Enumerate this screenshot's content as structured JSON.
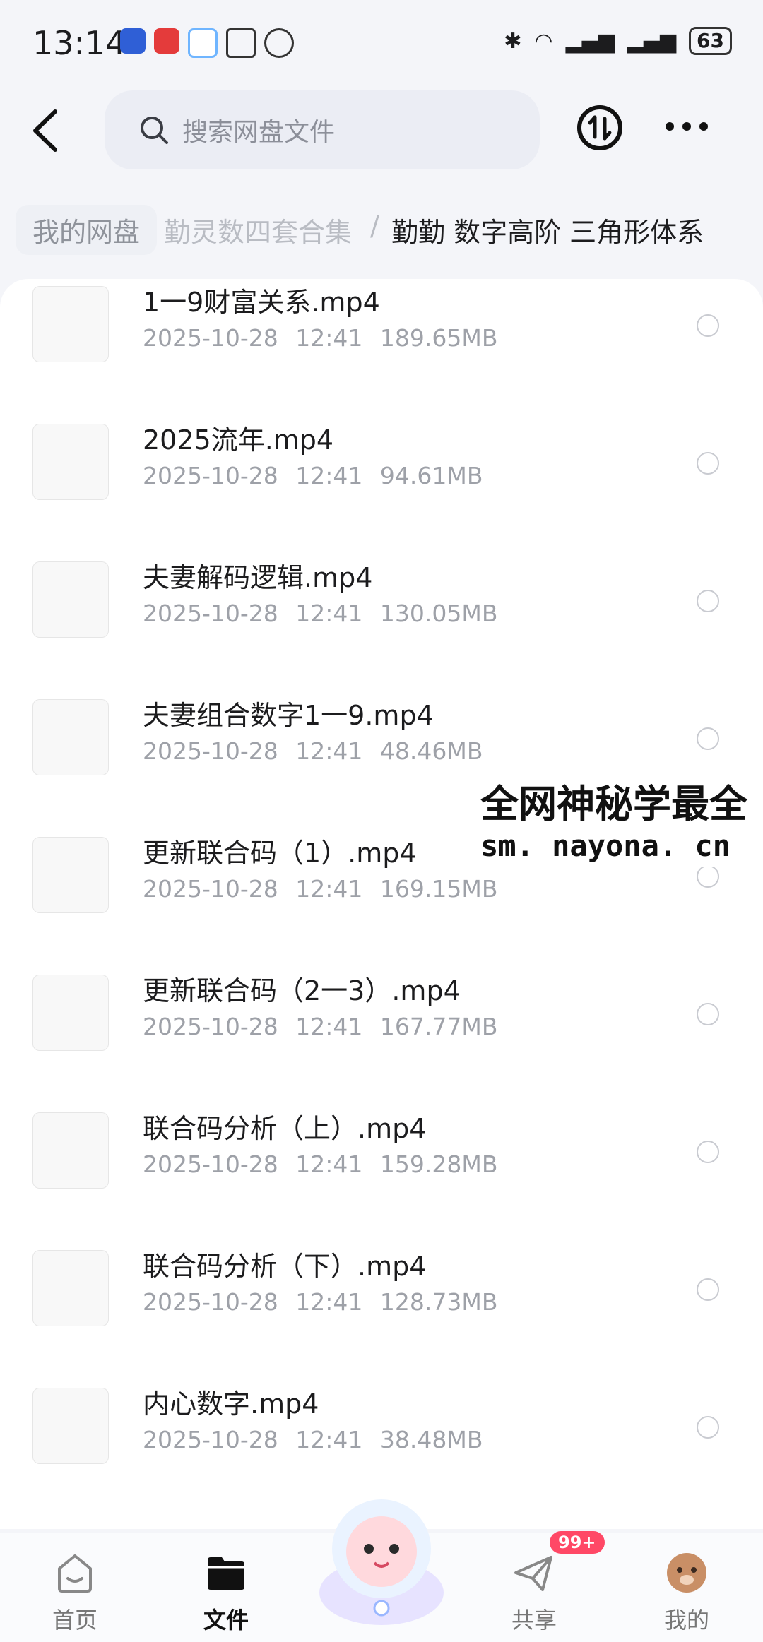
{
  "status_bar": {
    "time": "13:14",
    "battery": "63"
  },
  "header": {
    "search_placeholder": "搜索网盘文件"
  },
  "breadcrumb": {
    "root": "我的网盘",
    "middle": "勤灵数四套合集",
    "separator": "/",
    "current": "勤勤  数字高阶 三角形体系"
  },
  "files": [
    {
      "name": "1一9财富关系.mp4",
      "date": "2025-10-28",
      "time": "12:41",
      "size": "189.65MB"
    },
    {
      "name": "2025流年.mp4",
      "date": "2025-10-28",
      "time": "12:41",
      "size": "94.61MB"
    },
    {
      "name": "夫妻解码逻辑.mp4",
      "date": "2025-10-28",
      "time": "12:41",
      "size": "130.05MB"
    },
    {
      "name": "夫妻组合数字1一9.mp4",
      "date": "2025-10-28",
      "time": "12:41",
      "size": "48.46MB"
    },
    {
      "name": "更新联合码（1）.mp4",
      "date": "2025-10-28",
      "time": "12:41",
      "size": "169.15MB"
    },
    {
      "name": "更新联合码（2一3）.mp4",
      "date": "2025-10-28",
      "time": "12:41",
      "size": "167.77MB"
    },
    {
      "name": "联合码分析（上）.mp4",
      "date": "2025-10-28",
      "time": "12:41",
      "size": "159.28MB"
    },
    {
      "name": "联合码分析（下）.mp4",
      "date": "2025-10-28",
      "time": "12:41",
      "size": "128.73MB"
    },
    {
      "name": "内心数字.mp4",
      "date": "2025-10-28",
      "time": "12:41",
      "size": "38.48MB"
    }
  ],
  "watermark": {
    "title": "全网神秘学最全",
    "url": "sm. nayona. cn"
  },
  "nav": {
    "home": "首页",
    "files": "文件",
    "share": "共享",
    "mine": "我的",
    "share_badge": "99+"
  }
}
